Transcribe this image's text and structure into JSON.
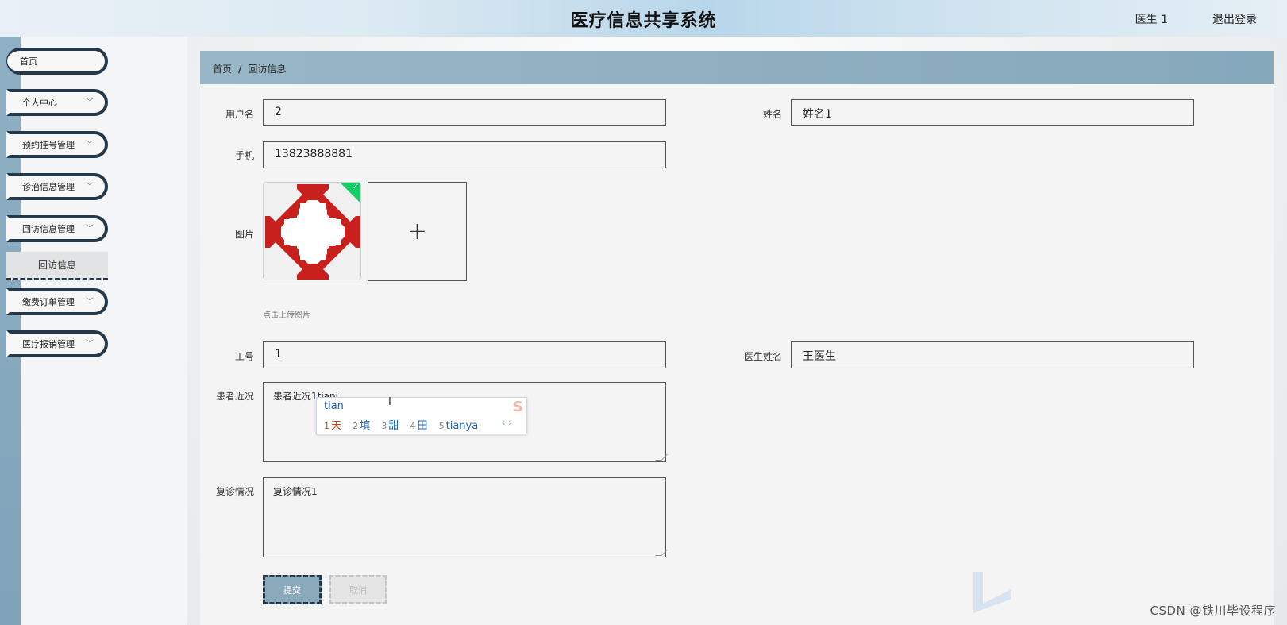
{
  "header": {
    "title": "医疗信息共享系统",
    "user": "医生 1",
    "logout": "退出登录"
  },
  "sidebar": {
    "items": [
      {
        "label": "首页",
        "has_chevron": false
      },
      {
        "label": "个人中心",
        "has_chevron": true
      },
      {
        "label": "预约挂号管理",
        "has_chevron": true
      },
      {
        "label": "诊治信息管理",
        "has_chevron": true
      },
      {
        "label": "回访信息管理",
        "has_chevron": true,
        "expanded": true
      },
      {
        "label": "缴费订单管理",
        "has_chevron": true
      },
      {
        "label": "医疗报销管理",
        "has_chevron": true
      }
    ],
    "submenu": {
      "label": "回访信息",
      "active": true
    },
    "chevron_char": "﹀"
  },
  "breadcrumb": {
    "home": "首页",
    "separator": "/",
    "current": "回访信息"
  },
  "form": {
    "username": {
      "label": "用户名",
      "value": "2"
    },
    "name": {
      "label": "姓名",
      "value": "姓名1"
    },
    "phone": {
      "label": "手机",
      "value": "13823888881"
    },
    "picture": {
      "label": "图片",
      "hint": "点击上传图片",
      "add_icon": "plus-icon",
      "uploaded": true
    },
    "job_no": {
      "label": "工号",
      "value": "1"
    },
    "doctor_name": {
      "label": "医生姓名",
      "value": "王医生"
    },
    "patient_status": {
      "label": "患者近况",
      "value": "患者近况1tianj"
    },
    "revisit": {
      "label": "复诊情况",
      "value": "复诊情况1"
    }
  },
  "ime": {
    "pinyin": "tian",
    "candidates": [
      {
        "n": "1",
        "text": "天",
        "selected": true
      },
      {
        "n": "2",
        "text": "填",
        "selected": false
      },
      {
        "n": "3",
        "text": "甜",
        "selected": false
      },
      {
        "n": "4",
        "text": "田",
        "selected": false
      },
      {
        "n": "5",
        "text": "tianya",
        "selected": false
      }
    ],
    "nav": "‹ ›"
  },
  "buttons": {
    "submit": "提交",
    "cancel": "取消"
  },
  "watermark": "CSDN @铁川毕设程序",
  "colors": {
    "sidebar_border": "#23384a",
    "breadcrumb_bg": "#8fb0c2",
    "submit_bg": "#8aa9bb",
    "cross_red": "#c8201d",
    "upload_success": "#13ce66"
  }
}
